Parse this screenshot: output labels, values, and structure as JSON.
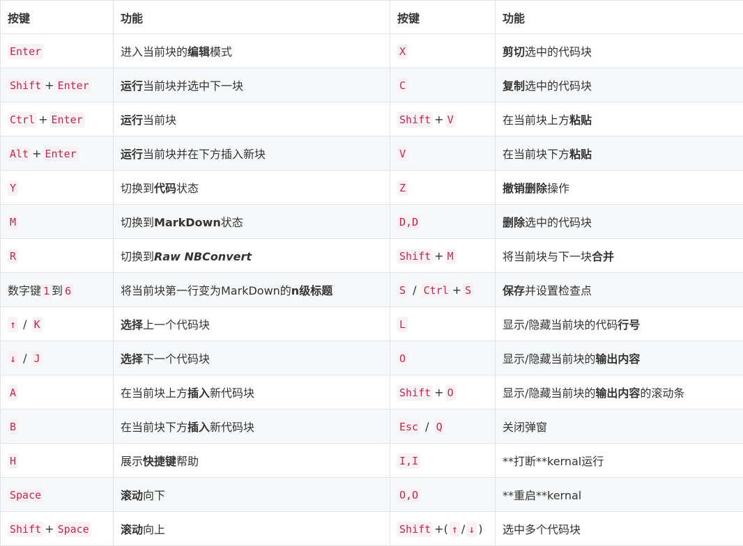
{
  "header": [
    "按键",
    "功能",
    "按键",
    "功能"
  ],
  "rows": [
    {
      "k1": [
        {
          "t": "code",
          "v": "Enter"
        }
      ],
      "f1": [
        {
          "t": "text",
          "v": "进入当前块的"
        },
        {
          "t": "bold",
          "v": "编辑"
        },
        {
          "t": "text",
          "v": "模式"
        }
      ],
      "k2": [
        {
          "t": "code",
          "v": "X"
        }
      ],
      "f2": [
        {
          "t": "bold",
          "v": "剪切"
        },
        {
          "t": "text",
          "v": "选中的代码块"
        }
      ]
    },
    {
      "k1": [
        {
          "t": "code",
          "v": "Shift"
        },
        {
          "t": "sep",
          "v": "+"
        },
        {
          "t": "code",
          "v": "Enter"
        }
      ],
      "f1": [
        {
          "t": "bold",
          "v": "运行"
        },
        {
          "t": "text",
          "v": "当前块并选中下一块"
        }
      ],
      "k2": [
        {
          "t": "code",
          "v": "C"
        }
      ],
      "f2": [
        {
          "t": "bold",
          "v": "复制"
        },
        {
          "t": "text",
          "v": "选中的代码块"
        }
      ]
    },
    {
      "k1": [
        {
          "t": "code",
          "v": "Ctrl"
        },
        {
          "t": "sep",
          "v": "+"
        },
        {
          "t": "code",
          "v": "Enter"
        }
      ],
      "f1": [
        {
          "t": "bold",
          "v": "运行"
        },
        {
          "t": "text",
          "v": "当前块"
        }
      ],
      "k2": [
        {
          "t": "code",
          "v": "Shift"
        },
        {
          "t": "sep",
          "v": "+"
        },
        {
          "t": "code",
          "v": "V"
        }
      ],
      "f2": [
        {
          "t": "text",
          "v": "在当前块上方"
        },
        {
          "t": "bold",
          "v": "粘贴"
        }
      ]
    },
    {
      "k1": [
        {
          "t": "code",
          "v": "Alt"
        },
        {
          "t": "sep",
          "v": "+"
        },
        {
          "t": "code",
          "v": "Enter"
        }
      ],
      "f1": [
        {
          "t": "bold",
          "v": "运行"
        },
        {
          "t": "text",
          "v": "当前块并在下方插入新块"
        }
      ],
      "k2": [
        {
          "t": "code",
          "v": "V"
        }
      ],
      "f2": [
        {
          "t": "text",
          "v": "在当前块下方"
        },
        {
          "t": "bold",
          "v": "粘贴"
        }
      ]
    },
    {
      "k1": [
        {
          "t": "code",
          "v": "Y"
        }
      ],
      "f1": [
        {
          "t": "text",
          "v": "切换到"
        },
        {
          "t": "bold",
          "v": "代码"
        },
        {
          "t": "text",
          "v": "状态"
        }
      ],
      "k2": [
        {
          "t": "code",
          "v": "Z"
        }
      ],
      "f2": [
        {
          "t": "bold",
          "v": "撤销删除"
        },
        {
          "t": "text",
          "v": "操作"
        }
      ]
    },
    {
      "k1": [
        {
          "t": "code",
          "v": "M"
        }
      ],
      "f1": [
        {
          "t": "text",
          "v": "切换到"
        },
        {
          "t": "bold",
          "v": "MarkDown"
        },
        {
          "t": "text",
          "v": "状态"
        }
      ],
      "k2": [
        {
          "t": "code",
          "v": "D,D"
        }
      ],
      "f2": [
        {
          "t": "bold",
          "v": "删除"
        },
        {
          "t": "text",
          "v": "选中的代码块"
        }
      ]
    },
    {
      "k1": [
        {
          "t": "code",
          "v": "R"
        }
      ],
      "f1": [
        {
          "t": "text",
          "v": "切换到"
        },
        {
          "t": "bolditalic",
          "v": "Raw NBConvert"
        }
      ],
      "k2": [
        {
          "t": "code",
          "v": "Shift"
        },
        {
          "t": "sep",
          "v": "+"
        },
        {
          "t": "code",
          "v": "M"
        }
      ],
      "f2": [
        {
          "t": "text",
          "v": "将当前块与下一块"
        },
        {
          "t": "bold",
          "v": "合并"
        }
      ]
    },
    {
      "k1": [
        {
          "t": "text",
          "v": "数字键"
        },
        {
          "t": "code",
          "v": "1"
        },
        {
          "t": "text",
          "v": "到"
        },
        {
          "t": "code",
          "v": "6"
        }
      ],
      "f1": [
        {
          "t": "text",
          "v": "将当前块第一行变为MarkDown的"
        },
        {
          "t": "bold",
          "v": "n级标题"
        }
      ],
      "k2": [
        {
          "t": "code",
          "v": "S"
        },
        {
          "t": "sep",
          "v": " / "
        },
        {
          "t": "code",
          "v": "Ctrl"
        },
        {
          "t": "sep",
          "v": "+"
        },
        {
          "t": "code",
          "v": "S"
        }
      ],
      "f2": [
        {
          "t": "bold",
          "v": "保存"
        },
        {
          "t": "text",
          "v": "并设置检查点"
        }
      ]
    },
    {
      "k1": [
        {
          "t": "code",
          "v": "↑"
        },
        {
          "t": "sep",
          "v": " / "
        },
        {
          "t": "code",
          "v": "K"
        }
      ],
      "f1": [
        {
          "t": "bold",
          "v": "选择"
        },
        {
          "t": "text",
          "v": "上一个代码块"
        }
      ],
      "k2": [
        {
          "t": "code",
          "v": "L"
        }
      ],
      "f2": [
        {
          "t": "text",
          "v": "显示/隐藏当前块的代码"
        },
        {
          "t": "bold",
          "v": "行号"
        }
      ]
    },
    {
      "k1": [
        {
          "t": "code",
          "v": "↓"
        },
        {
          "t": "sep",
          "v": " / "
        },
        {
          "t": "code",
          "v": "J"
        }
      ],
      "f1": [
        {
          "t": "bold",
          "v": "选择"
        },
        {
          "t": "text",
          "v": "下一个代码块"
        }
      ],
      "k2": [
        {
          "t": "code",
          "v": "O"
        }
      ],
      "f2": [
        {
          "t": "text",
          "v": "显示/隐藏当前块的"
        },
        {
          "t": "bold",
          "v": "输出内容"
        }
      ]
    },
    {
      "k1": [
        {
          "t": "code",
          "v": "A"
        }
      ],
      "f1": [
        {
          "t": "text",
          "v": "在当前块上方"
        },
        {
          "t": "bold",
          "v": "插入"
        },
        {
          "t": "text",
          "v": "新代码块"
        }
      ],
      "k2": [
        {
          "t": "code",
          "v": "Shift"
        },
        {
          "t": "sep",
          "v": "+"
        },
        {
          "t": "code",
          "v": "O"
        }
      ],
      "f2": [
        {
          "t": "text",
          "v": "显示/隐藏当前块的"
        },
        {
          "t": "bold",
          "v": "输出内容"
        },
        {
          "t": "text",
          "v": "的滚动条"
        }
      ]
    },
    {
      "k1": [
        {
          "t": "code",
          "v": "B"
        }
      ],
      "f1": [
        {
          "t": "text",
          "v": "在当前块下方"
        },
        {
          "t": "bold",
          "v": "插入"
        },
        {
          "t": "text",
          "v": "新代码块"
        }
      ],
      "k2": [
        {
          "t": "code",
          "v": "Esc"
        },
        {
          "t": "sep",
          "v": " / "
        },
        {
          "t": "code",
          "v": "Q"
        }
      ],
      "f2": [
        {
          "t": "text",
          "v": "关闭弹窗"
        }
      ]
    },
    {
      "k1": [
        {
          "t": "code",
          "v": "H"
        }
      ],
      "f1": [
        {
          "t": "text",
          "v": "展示"
        },
        {
          "t": "bold",
          "v": "快捷键"
        },
        {
          "t": "text",
          "v": "帮助"
        }
      ],
      "k2": [
        {
          "t": "code",
          "v": "I,I"
        }
      ],
      "f2": [
        {
          "t": "text",
          "v": "**打断**kernal运行"
        }
      ]
    },
    {
      "k1": [
        {
          "t": "code",
          "v": "Space"
        }
      ],
      "f1": [
        {
          "t": "bold",
          "v": "滚动"
        },
        {
          "t": "text",
          "v": "向下"
        }
      ],
      "k2": [
        {
          "t": "code",
          "v": "O,O"
        }
      ],
      "f2": [
        {
          "t": "text",
          "v": "**重启**kernal"
        }
      ]
    },
    {
      "k1": [
        {
          "t": "code",
          "v": "Shift"
        },
        {
          "t": "sep",
          "v": "+"
        },
        {
          "t": "code",
          "v": "Space"
        }
      ],
      "f1": [
        {
          "t": "bold",
          "v": "滚动"
        },
        {
          "t": "text",
          "v": "向上"
        }
      ],
      "k2": [
        {
          "t": "code",
          "v": "Shift"
        },
        {
          "t": "sep",
          "v": "+("
        },
        {
          "t": "code",
          "v": "↑"
        },
        {
          "t": "sep",
          "v": "/"
        },
        {
          "t": "code",
          "v": "↓"
        },
        {
          "t": "sep",
          "v": ")"
        }
      ],
      "f2": [
        {
          "t": "text",
          "v": "选中多个代码块"
        }
      ]
    }
  ]
}
